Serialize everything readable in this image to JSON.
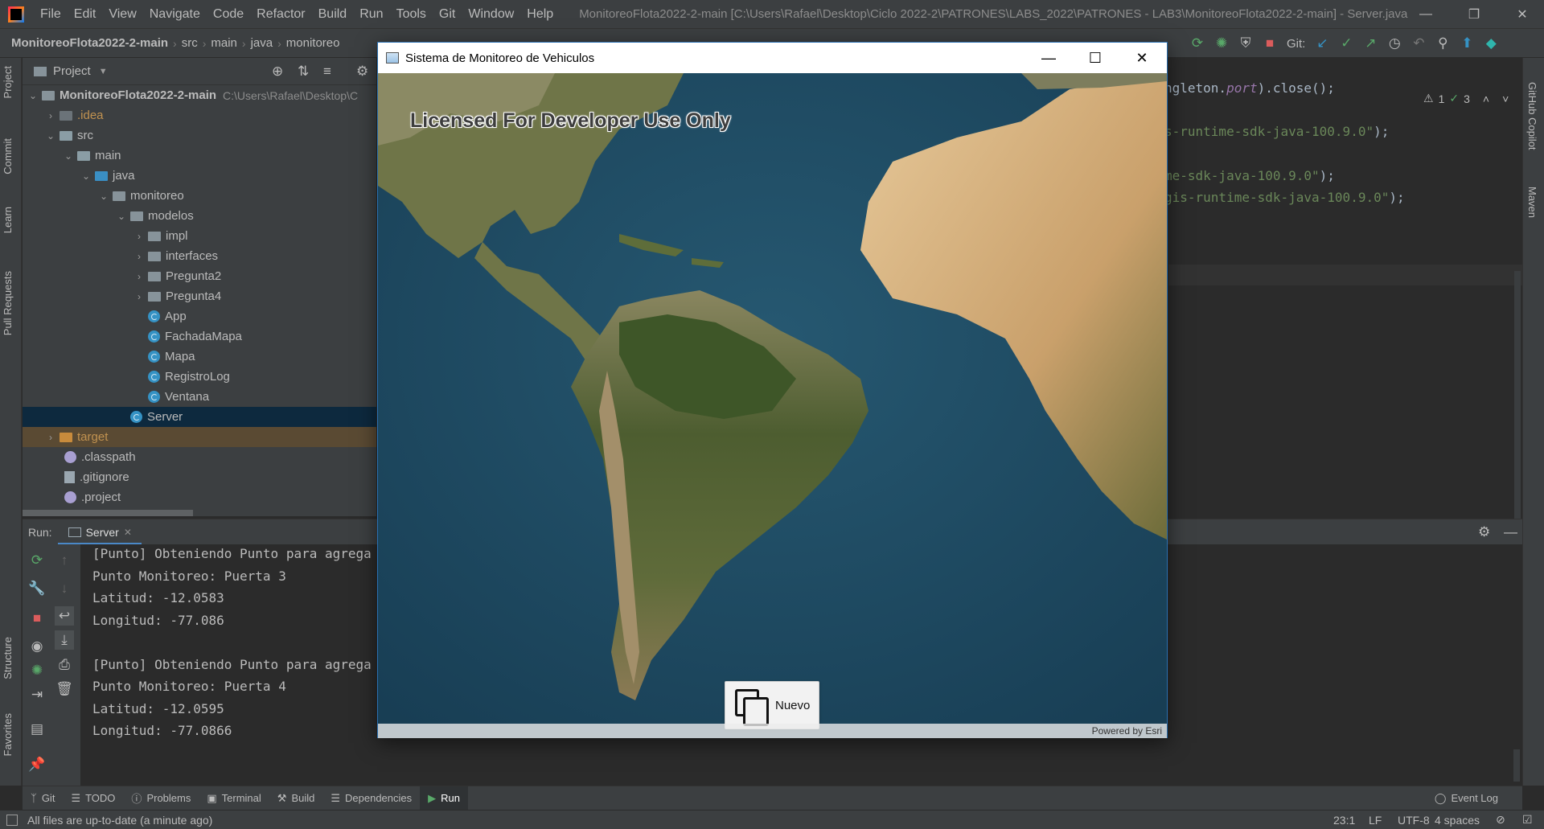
{
  "ide": {
    "menu": [
      "File",
      "Edit",
      "View",
      "Navigate",
      "Code",
      "Refactor",
      "Build",
      "Run",
      "Tools",
      "Git",
      "Window",
      "Help"
    ],
    "window_title": "MonitoreoFlota2022-2-main [C:\\Users\\Rafael\\Desktop\\Ciclo 2022-2\\PATRONES\\LABS_2022\\PATRONES - LAB3\\MonitoreoFlota2022-2-main] - Server.java",
    "breadcrumb": [
      "MonitoreoFlota2022-2-main",
      "src",
      "main",
      "java",
      "monitoreo"
    ],
    "git_label": "Git:",
    "warnings": "1",
    "checks": "3"
  },
  "left_tabs": [
    "Project",
    "Commit",
    "Learn",
    "Pull Requests",
    "Structure",
    "Favorites"
  ],
  "right_tabs": [
    "GitHub Copilot",
    "Maven"
  ],
  "project": {
    "header": "Project",
    "root_name": "MonitoreoFlota2022-2-main",
    "root_path": "C:\\Users\\Rafael\\Desktop\\C",
    "tree": [
      {
        "label": ".idea"
      },
      {
        "label": "src"
      },
      {
        "label": "main"
      },
      {
        "label": "java"
      },
      {
        "label": "monitoreo"
      },
      {
        "label": "modelos"
      },
      {
        "label": "impl"
      },
      {
        "label": "interfaces"
      },
      {
        "label": "Pregunta2"
      },
      {
        "label": "Pregunta4"
      },
      {
        "label": "App"
      },
      {
        "label": "FachadaMapa"
      },
      {
        "label": "Mapa"
      },
      {
        "label": "RegistroLog"
      },
      {
        "label": "Ventana"
      },
      {
        "label": "Server"
      },
      {
        "label": "target"
      },
      {
        "label": ".classpath"
      },
      {
        "label": ".gitignore"
      },
      {
        "label": ".project"
      }
    ]
  },
  "editor": {
    "lines": [
      {
        "prefix": "ngleton.",
        "italic": "port",
        "suffix": ").close();"
      },
      {
        "str": "s-runtime-sdk-java-100.9.0\"",
        "suffix": ");"
      },
      {
        "str": "me-sdk-java-100.9.0\"",
        "suffix": ");"
      },
      {
        "str": "gis-runtime-sdk-java-100.9.0\"",
        "suffix": ");"
      }
    ]
  },
  "run": {
    "label": "Run:",
    "tab": "Server",
    "console": [
      "[Punto] Obteniendo Punto para agrega",
      "Punto Monitoreo: Puerta 3",
      "Latitud: -12.0583",
      "Longitud: -77.086",
      "",
      "[Punto] Obteniendo Punto para agrega",
      "Punto Monitoreo: Puerta 4",
      "Latitud: -12.0595",
      "Longitud: -77.0866"
    ]
  },
  "bottom_tabs": [
    "Git",
    "TODO",
    "Problems",
    "Terminal",
    "Build",
    "Dependencies",
    "Run"
  ],
  "event_log": "Event Log",
  "status": {
    "message": "All files are up-to-date (a minute ago)",
    "position": "23:1",
    "line_sep": "LF",
    "encoding": "UTF-8",
    "indent": "4 spaces"
  },
  "app_window": {
    "title": "Sistema de Monitoreo de Vehiculos",
    "license": "Licensed For Developer Use Only",
    "attribution": "Powered by Esri",
    "button": "Nuevo"
  },
  "colors": {
    "ide_bg": "#2b2b2b",
    "panel_bg": "#3c3f41",
    "selection": "#0d293e",
    "ocean": "#1f4a63",
    "land": "#5b6a3a"
  }
}
